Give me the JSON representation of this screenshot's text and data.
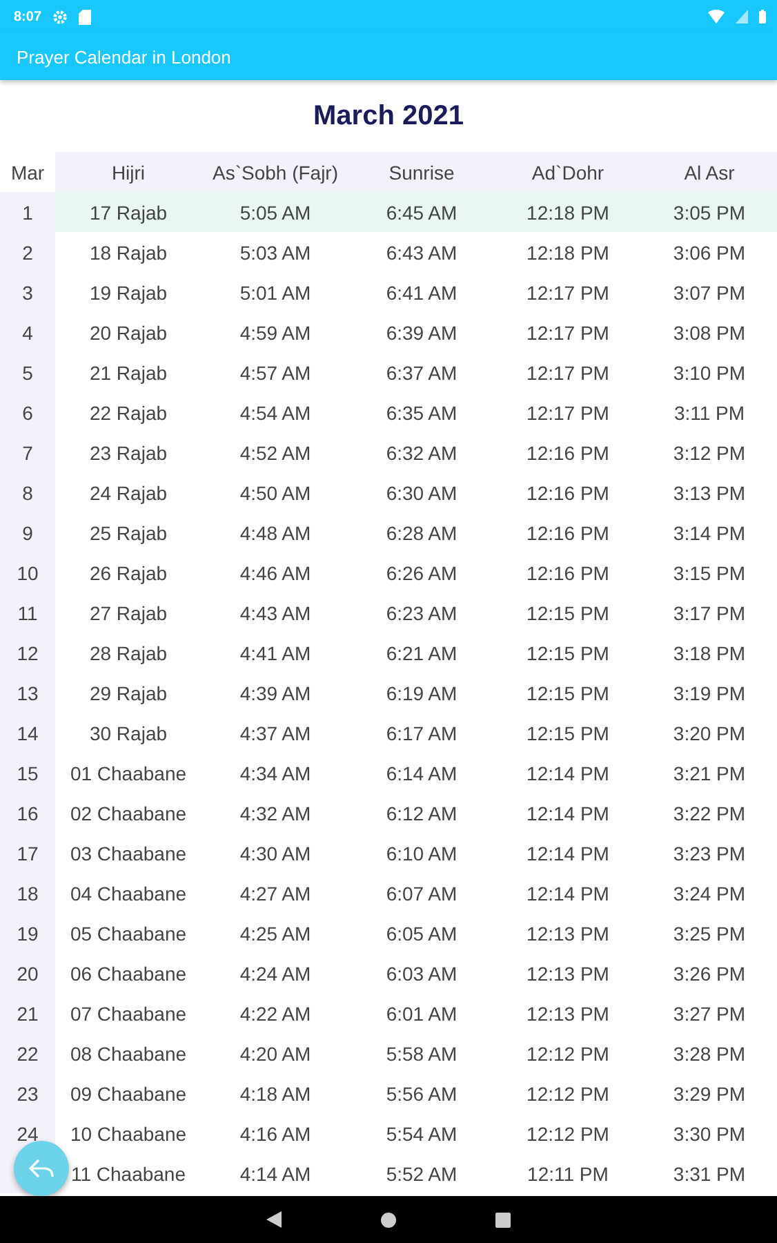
{
  "status_bar": {
    "time": "8:07"
  },
  "app_bar": {
    "title": "Prayer Calendar in London"
  },
  "calendar": {
    "title": "March 2021",
    "columns": [
      "Mar",
      "Hijri",
      "As`Sobh (Fajr)",
      "Sunrise",
      "Ad`Dohr",
      "Al Asr"
    ],
    "rows": [
      {
        "day": "1",
        "hijri": "17 Rajab",
        "fajr": "5:05 AM",
        "sunrise": "6:45 AM",
        "dohr": "12:18 PM",
        "asr": "3:05 PM",
        "selected": true
      },
      {
        "day": "2",
        "hijri": "18 Rajab",
        "fajr": "5:03 AM",
        "sunrise": "6:43 AM",
        "dohr": "12:18 PM",
        "asr": "3:06 PM",
        "selected": false
      },
      {
        "day": "3",
        "hijri": "19 Rajab",
        "fajr": "5:01 AM",
        "sunrise": "6:41 AM",
        "dohr": "12:17 PM",
        "asr": "3:07 PM",
        "selected": false
      },
      {
        "day": "4",
        "hijri": "20 Rajab",
        "fajr": "4:59 AM",
        "sunrise": "6:39 AM",
        "dohr": "12:17 PM",
        "asr": "3:08 PM",
        "selected": false
      },
      {
        "day": "5",
        "hijri": "21 Rajab",
        "fajr": "4:57 AM",
        "sunrise": "6:37 AM",
        "dohr": "12:17 PM",
        "asr": "3:10 PM",
        "selected": false
      },
      {
        "day": "6",
        "hijri": "22 Rajab",
        "fajr": "4:54 AM",
        "sunrise": "6:35 AM",
        "dohr": "12:17 PM",
        "asr": "3:11 PM",
        "selected": false
      },
      {
        "day": "7",
        "hijri": "23 Rajab",
        "fajr": "4:52 AM",
        "sunrise": "6:32 AM",
        "dohr": "12:16 PM",
        "asr": "3:12 PM",
        "selected": false
      },
      {
        "day": "8",
        "hijri": "24 Rajab",
        "fajr": "4:50 AM",
        "sunrise": "6:30 AM",
        "dohr": "12:16 PM",
        "asr": "3:13 PM",
        "selected": false
      },
      {
        "day": "9",
        "hijri": "25 Rajab",
        "fajr": "4:48 AM",
        "sunrise": "6:28 AM",
        "dohr": "12:16 PM",
        "asr": "3:14 PM",
        "selected": false
      },
      {
        "day": "10",
        "hijri": "26 Rajab",
        "fajr": "4:46 AM",
        "sunrise": "6:26 AM",
        "dohr": "12:16 PM",
        "asr": "3:15 PM",
        "selected": false
      },
      {
        "day": "11",
        "hijri": "27 Rajab",
        "fajr": "4:43 AM",
        "sunrise": "6:23 AM",
        "dohr": "12:15 PM",
        "asr": "3:17 PM",
        "selected": false
      },
      {
        "day": "12",
        "hijri": "28 Rajab",
        "fajr": "4:41 AM",
        "sunrise": "6:21 AM",
        "dohr": "12:15 PM",
        "asr": "3:18 PM",
        "selected": false
      },
      {
        "day": "13",
        "hijri": "29 Rajab",
        "fajr": "4:39 AM",
        "sunrise": "6:19 AM",
        "dohr": "12:15 PM",
        "asr": "3:19 PM",
        "selected": false
      },
      {
        "day": "14",
        "hijri": "30 Rajab",
        "fajr": "4:37 AM",
        "sunrise": "6:17 AM",
        "dohr": "12:15 PM",
        "asr": "3:20 PM",
        "selected": false
      },
      {
        "day": "15",
        "hijri": "01 Chaabane",
        "fajr": "4:34 AM",
        "sunrise": "6:14 AM",
        "dohr": "12:14 PM",
        "asr": "3:21 PM",
        "selected": false
      },
      {
        "day": "16",
        "hijri": "02 Chaabane",
        "fajr": "4:32 AM",
        "sunrise": "6:12 AM",
        "dohr": "12:14 PM",
        "asr": "3:22 PM",
        "selected": false
      },
      {
        "day": "17",
        "hijri": "03 Chaabane",
        "fajr": "4:30 AM",
        "sunrise": "6:10 AM",
        "dohr": "12:14 PM",
        "asr": "3:23 PM",
        "selected": false
      },
      {
        "day": "18",
        "hijri": "04 Chaabane",
        "fajr": "4:27 AM",
        "sunrise": "6:07 AM",
        "dohr": "12:14 PM",
        "asr": "3:24 PM",
        "selected": false
      },
      {
        "day": "19",
        "hijri": "05 Chaabane",
        "fajr": "4:25 AM",
        "sunrise": "6:05 AM",
        "dohr": "12:13 PM",
        "asr": "3:25 PM",
        "selected": false
      },
      {
        "day": "20",
        "hijri": "06 Chaabane",
        "fajr": "4:24 AM",
        "sunrise": "6:03 AM",
        "dohr": "12:13 PM",
        "asr": "3:26 PM",
        "selected": false
      },
      {
        "day": "21",
        "hijri": "07 Chaabane",
        "fajr": "4:22 AM",
        "sunrise": "6:01 AM",
        "dohr": "12:13 PM",
        "asr": "3:27 PM",
        "selected": false
      },
      {
        "day": "22",
        "hijri": "08 Chaabane",
        "fajr": "4:20 AM",
        "sunrise": "5:58 AM",
        "dohr": "12:12 PM",
        "asr": "3:28 PM",
        "selected": false
      },
      {
        "day": "23",
        "hijri": "09 Chaabane",
        "fajr": "4:18 AM",
        "sunrise": "5:56 AM",
        "dohr": "12:12 PM",
        "asr": "3:29 PM",
        "selected": false
      },
      {
        "day": "24",
        "hijri": "10 Chaabane",
        "fajr": "4:16 AM",
        "sunrise": "5:54 AM",
        "dohr": "12:12 PM",
        "asr": "3:30 PM",
        "selected": false
      },
      {
        "hijri": "11 Chaabane",
        "fajr": "4:14 AM",
        "sunrise": "5:52 AM",
        "dohr": "12:11 PM",
        "asr": "3:31 PM",
        "selected": false
      }
    ]
  }
}
